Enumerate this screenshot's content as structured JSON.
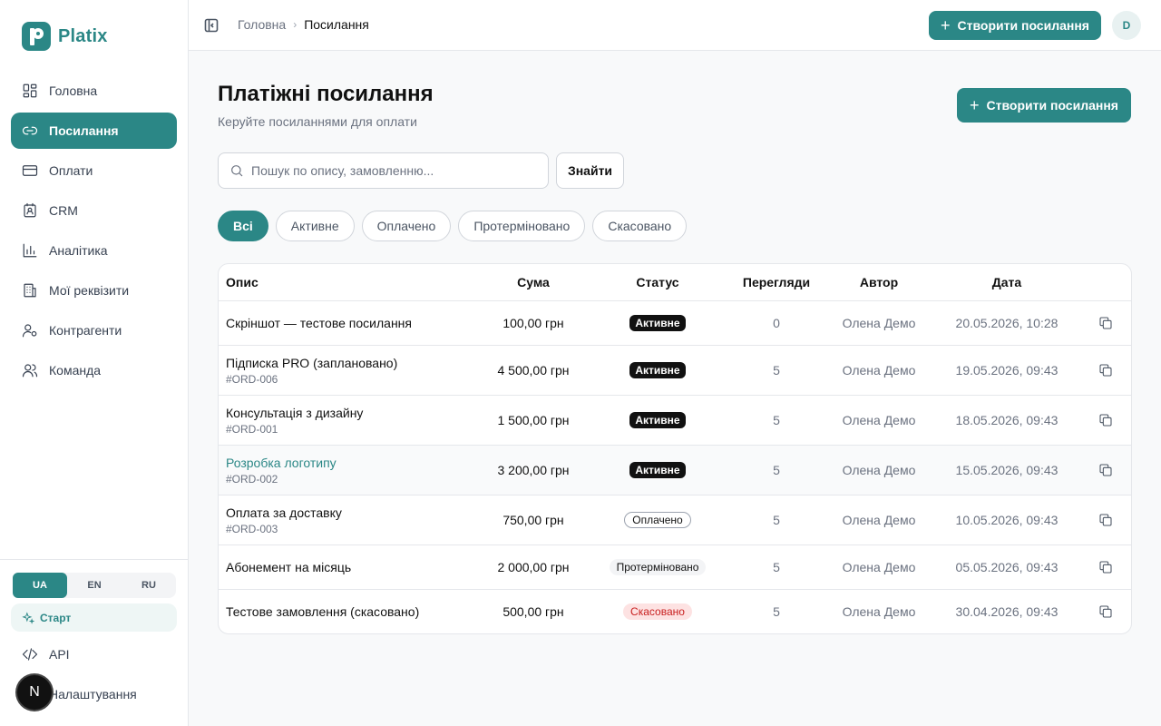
{
  "app": {
    "name": "Platix"
  },
  "sidebar": {
    "items": [
      {
        "label": "Головна",
        "icon": "dashboard-icon"
      },
      {
        "label": "Посилання",
        "icon": "link-icon",
        "active": true
      },
      {
        "label": "Оплати",
        "icon": "credit-card-icon"
      },
      {
        "label": "CRM",
        "icon": "contacts-icon"
      },
      {
        "label": "Аналітика",
        "icon": "bar-chart-icon"
      },
      {
        "label": "Мої реквізити",
        "icon": "building-icon"
      },
      {
        "label": "Контрагенти",
        "icon": "user-gear-icon"
      },
      {
        "label": "Команда",
        "icon": "users-icon"
      }
    ],
    "languages": [
      "UA",
      "EN",
      "RU"
    ],
    "active_language": "UA",
    "start_label": "Старт",
    "api_label": "API",
    "settings_label": "Налаштування",
    "badge_letter": "N"
  },
  "topbar": {
    "breadcrumb": [
      "Головна",
      "Посилання"
    ],
    "create_label": "Створити посилання",
    "avatar_initial": "D"
  },
  "main": {
    "title": "Платіжні посилання",
    "subtitle": "Керуйте посиланнями для оплати",
    "create_label": "Створити посилання",
    "search_placeholder": "Пошук по опису, замовленню...",
    "search_value": "",
    "find_label": "Знайти",
    "filters": [
      "Всі",
      "Активне",
      "Оплачено",
      "Протерміновано",
      "Скасовано"
    ],
    "active_filter": "Всі"
  },
  "table": {
    "columns": [
      "Опис",
      "Сума",
      "Статус",
      "Перегляди",
      "Автор",
      "Дата"
    ],
    "rows": [
      {
        "title": "Скріншот — тестове посилання",
        "order": "",
        "amount": "100,00 грн",
        "status": "Активне",
        "status_type": "active",
        "views": "0",
        "author": "Олена Демо",
        "date": "20.05.2026, 10:28"
      },
      {
        "title": "Підписка PRO (заплановано)",
        "order": "#ORD-006",
        "amount": "4 500,00 грн",
        "status": "Активне",
        "status_type": "active",
        "views": "5",
        "author": "Олена Демо",
        "date": "19.05.2026, 09:43"
      },
      {
        "title": "Консультація з дизайну",
        "order": "#ORD-001",
        "amount": "1 500,00 грн",
        "status": "Активне",
        "status_type": "active",
        "views": "5",
        "author": "Олена Демо",
        "date": "18.05.2026, 09:43"
      },
      {
        "title": "Розробка логотипу",
        "order": "#ORD-002",
        "amount": "3 200,00 грн",
        "status": "Активне",
        "status_type": "active",
        "views": "5",
        "author": "Олена Демо",
        "date": "15.05.2026, 09:43"
      },
      {
        "title": "Оплата за доставку",
        "order": "#ORD-003",
        "amount": "750,00 грн",
        "status": "Оплачено",
        "status_type": "paid",
        "views": "5",
        "author": "Олена Демо",
        "date": "10.05.2026, 09:43"
      },
      {
        "title": "Абонемент на місяць",
        "order": "",
        "amount": "2 000,00 грн",
        "status": "Протерміновано",
        "status_type": "expired",
        "views": "5",
        "author": "Олена Демо",
        "date": "05.05.2026, 09:43"
      },
      {
        "title": "Тестове замовлення (скасовано)",
        "order": "",
        "amount": "500,00 грн",
        "status": "Скасовано",
        "status_type": "cancelled",
        "views": "5",
        "author": "Олена Демо",
        "date": "30.04.2026, 09:43"
      }
    ]
  },
  "colors": {
    "accent": "#2b8786",
    "cancel": "#c81e1e"
  }
}
